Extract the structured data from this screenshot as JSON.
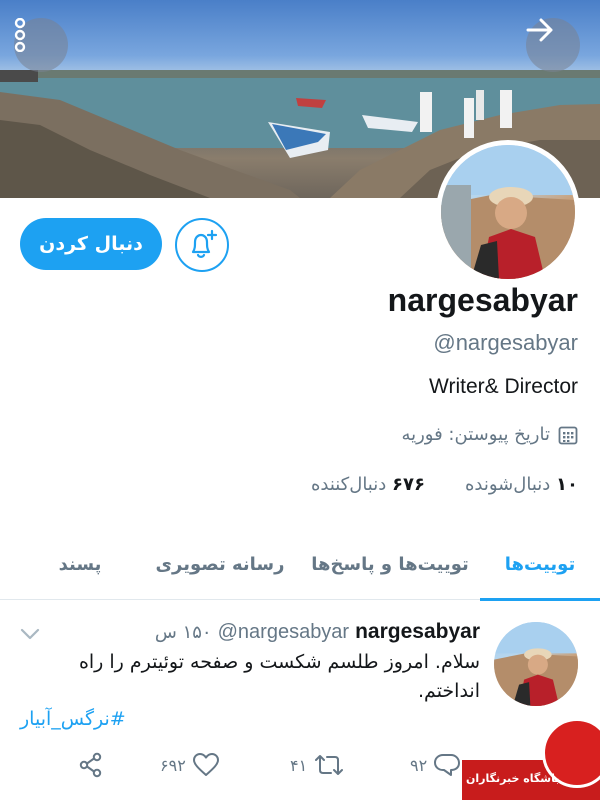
{
  "profile": {
    "name": "nargesabyar",
    "handle": "@nargesabyar",
    "bio": "Writer& Director",
    "joined": "تاریخ پیوستن: فوریه",
    "follow_label": "دنبال کردن",
    "following_count": "۱۰",
    "following_label": "دنبال‌شونده",
    "followers_count": "۶۷۶",
    "followers_label": "دنبال‌کننده"
  },
  "tabs": [
    {
      "label": "توییت‌ها",
      "active": true
    },
    {
      "label": "توییت‌ها و پاسخ‌ها",
      "active": false
    },
    {
      "label": "رسانه تصویری",
      "active": false
    },
    {
      "label": "پسند",
      "active": false
    }
  ],
  "tweet": {
    "name": "nargesabyar",
    "handle": "@nargesabyar",
    "time": "۱۵۰ س",
    "text": "سلام. امروز طلسم شکست و صفحه توئیترم را راه انداختم.",
    "hashtag": "#نرگس_آبیار",
    "replies": "۹۲",
    "retweets": "۴۱",
    "likes": "۶۹۲"
  },
  "watermark": {
    "text": "باشگاه خبرنگاران"
  },
  "icons": {
    "more": "more-vertical-icon",
    "share": "arrow-right-icon",
    "notify": "bell-plus-icon",
    "calendar": "calendar-icon",
    "chevron": "chevron-down-icon",
    "reply": "reply-icon",
    "retweet": "retweet-icon",
    "like": "heart-icon",
    "share_tweet": "share-icon"
  },
  "colors": {
    "accent": "#1da1f2",
    "muted": "#657786",
    "text": "#14171a"
  }
}
